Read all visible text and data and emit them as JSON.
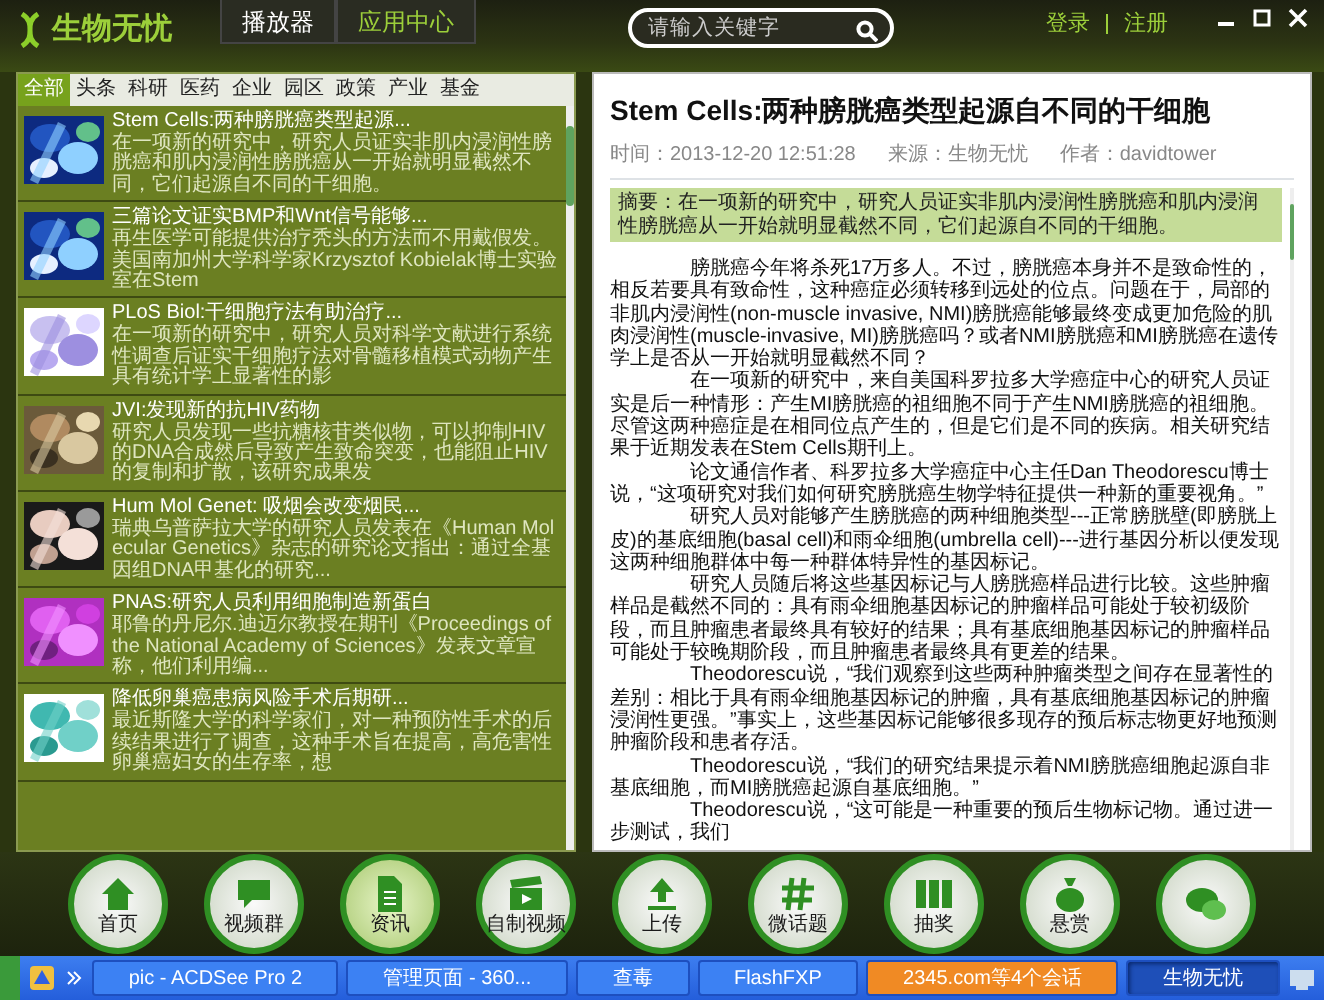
{
  "app": {
    "logo": "生物无忧",
    "tabs": [
      {
        "label": "播放器",
        "selected": false
      },
      {
        "label": "应用中心",
        "selected": true
      }
    ],
    "search": {
      "placeholder": "请输入关键字"
    },
    "account": [
      "登录",
      "注册"
    ]
  },
  "categories": [
    {
      "label": "全部",
      "selected": true
    },
    {
      "label": "头条",
      "selected": false
    },
    {
      "label": "科研",
      "selected": false
    },
    {
      "label": "医药",
      "selected": false
    },
    {
      "label": "企业",
      "selected": false
    },
    {
      "label": "园区",
      "selected": false
    },
    {
      "label": "政策",
      "selected": false
    },
    {
      "label": "产业",
      "selected": false
    },
    {
      "label": "基金",
      "selected": false
    }
  ],
  "news": [
    {
      "title": "Stem Cells:两种膀胱癌类型起源...",
      "summary": "在一项新的研究中，研究人员证实非肌内浸润性膀胱癌和肌内浸润性膀胱癌从一开始就明显截然不同，它们起源自不同的干细胞。"
    },
    {
      "title": "三篇论文证实BMP和Wnt信号能够...",
      "summary": "再生医学可能提供治疗秃头的方法而不用戴假发。美国南加州大学科学家Krzysztof Kobielak博士实验室在Stem"
    },
    {
      "title": "PLoS Biol:干细胞疗法有助治疗...",
      "summary": "在一项新的研究中，研究人员对科学文献进行系统性调查后证实干细胞疗法对骨髓移植模式动物产生具有统计学上显著性的影"
    },
    {
      "title": "JVI:发现新的抗HIV药物",
      "summary": "研究人员发现一些抗糖核苷类似物，可以抑制HIV的DNA合成然后导致产生致命突变，也能阻止HIV的复制和扩散，该研究成果发"
    },
    {
      "title": "Hum Mol Genet: 吸烟会改变烟民...",
      "summary": "瑞典乌普萨拉大学的研究人员发表在《Human Molecular Genetics》杂志的研究论文指出：通过全基因组DNA甲基化的研究..."
    },
    {
      "title": "PNAS:研究人员利用细胞制造新蛋白",
      "summary": "耶鲁的丹尼尔.迪迈尔教授在期刊《Proceedings of the National Academy of Sciences》发表文章宣称，他们利用编..."
    },
    {
      "title": "降低卵巢癌患病风险手术后期研...",
      "summary": "最近斯隆大学的科学家们，对一种预防性手术的后续结果进行了调查，这种手术旨在提高，高危害性卵巢癌妇女的生存率，想"
    }
  ],
  "article": {
    "title": "Stem Cells:两种膀胱癌类型起源自不同的干细胞",
    "meta": [
      "时间：2013-12-20 12:51:28",
      "来源：生物无忧",
      "作者：davidtower"
    ],
    "abstract": "摘要：在一项新的研究中，研究人员证实非肌内浸润性膀胱癌和肌内浸润性膀胱癌从一开始就明显截然不同，它们起源自不同的干细胞。",
    "paragraphs": [
      "膀胱癌今年将杀死17万多人。不过，膀胱癌本身并不是致命性的，相反若要具有致命性，这种癌症必须转移到远处的位点。问题在于，局部的非肌内浸润性(non-muscle invasive, NMI)膀胱癌能够最终变成更加危险的肌肉浸润性(muscle-invasive, MI)膀胱癌吗？或者NMI膀胱癌和MI膀胱癌在遗传学上是否从一开始就明显截然不同？",
      "在一项新的研究中，来自美国科罗拉多大学癌症中心的研究人员证实是后一种情形：产生MI膀胱癌的祖细胞不同于产生NMI膀胱癌的祖细胞。尽管这两种癌症是在相同位点产生的，但是它们是不同的疾病。相关研究结果于近期发表在Stem Cells期刊上。",
      "论文通信作者、科罗拉多大学癌症中心主任Dan Theodorescu博士说，“这项研究对我们如何研究膀胱癌生物学特征提供一种新的重要视角。”",
      "研究人员对能够产生膀胱癌的两种细胞类型---正常膀胱壁(即膀胱上皮)的基底细胞(basal cell)和雨伞细胞(umbrella cell)---进行基因分析以便发现这两种细胞群体中每一种群体特异性的基因标记。",
      "研究人员随后将这些基因标记与人膀胱癌样品进行比较。这些肿瘤样品是截然不同的：具有雨伞细胞基因标记的肿瘤样品可能处于较初级阶段，而且肿瘤患者最终具有较好的结果；具有基底细胞基因标记的肿瘤样品可能处于较晚期阶段，而且肿瘤患者最终具有更差的结果。",
      "Theodorescu说，“我们观察到这些两种肿瘤类型之间存在显著性的差别：相比于具有雨伞细胞基因标记的肿瘤，具有基底细胞基因标记的肿瘤浸润性更强。”事实上，这些基因标记能够很多现存的预后标志物更好地预测肿瘤阶段和患者存活。",
      "Theodorescu说，“我们的研究结果提示着NMI膀胱癌细胞起源自非基底细胞，而MI膀胱癌起源自基底细胞。”",
      "Theodorescu说，“这可能是一种重要的预后生物标记物。通过进一步测试，我们"
    ]
  },
  "dock": [
    {
      "label": "首页",
      "selected": false
    },
    {
      "label": "视频群",
      "selected": false
    },
    {
      "label": "资讯",
      "selected": true
    },
    {
      "label": "自制视频",
      "selected": false
    },
    {
      "label": "上传",
      "selected": false
    },
    {
      "label": "微话题",
      "selected": false
    },
    {
      "label": "抽奖",
      "selected": false
    },
    {
      "label": "悬赏",
      "selected": false
    }
  ],
  "taskbar": [
    {
      "label": "pic - ACDSee Pro 2",
      "selected": false,
      "flashing": false
    },
    {
      "label": "管理页面 - 360...",
      "selected": false,
      "flashing": false
    },
    {
      "label": "查毒",
      "selected": false,
      "flashing": false
    },
    {
      "label": "FlashFXP",
      "selected": false,
      "flashing": false
    },
    {
      "label": "2345.com等4个会话",
      "selected": false,
      "flashing": true
    },
    {
      "label": "生物无忧",
      "selected": true,
      "flashing": false
    }
  ]
}
